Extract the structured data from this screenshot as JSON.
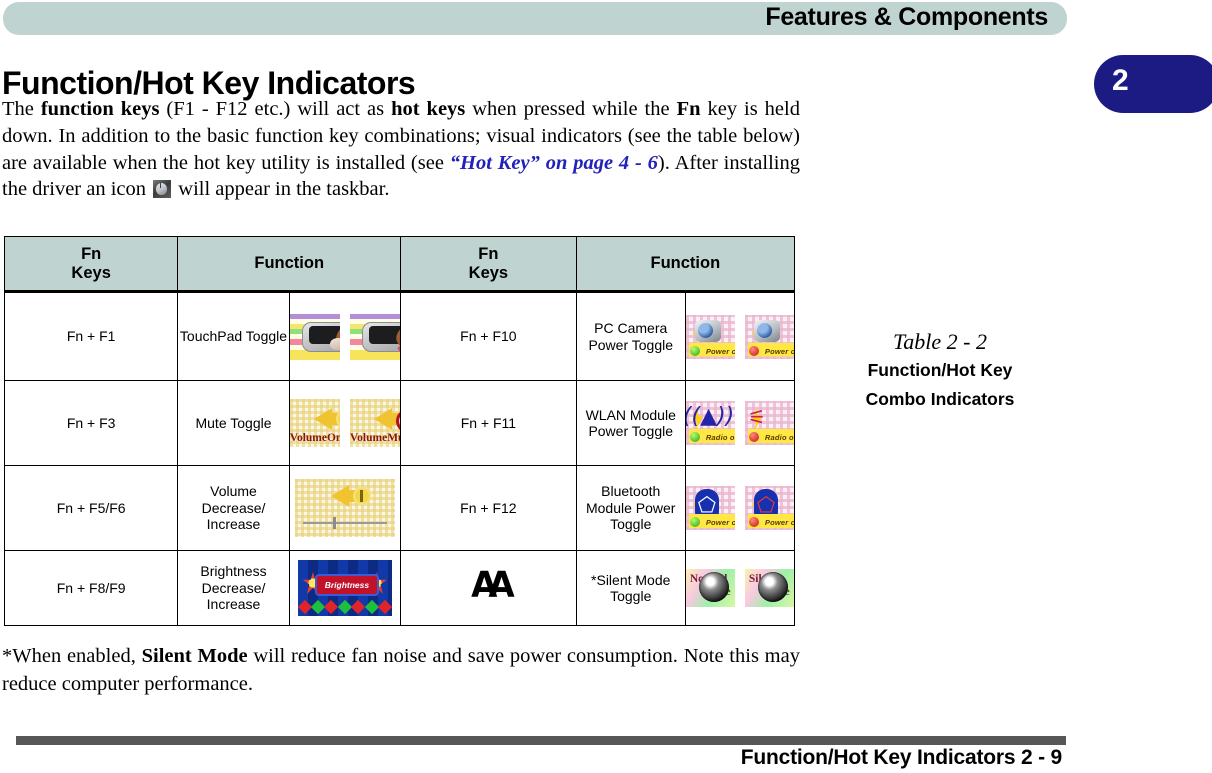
{
  "header": {
    "banner_title": "Features & Components",
    "chapter_number": "2"
  },
  "page_title": "Function/Hot Key Indicators",
  "intro": {
    "p1": "The ",
    "b1": "function keys",
    "p2": " (F1 - F12 etc.) will act as ",
    "b2": "hot keys",
    "p3": " when pressed while the ",
    "b3": "Fn",
    "p4": " key is held down. In addition to the basic function key combinations; visual indicators (see the table below) are available when the hot key utility is installed (see ",
    "xref": "“Hot Key” on page 4 - 6",
    "p5": "). After installing the driver an icon ",
    "p6": " will appear in the taskbar.",
    "taskbar_icon_name": "hotkey-taskbar-icon"
  },
  "table": {
    "headers": [
      "Fn\nKeys",
      "Function",
      "Fn\nKeys",
      "Function"
    ],
    "headers_flat": {
      "fn_keys_1": "Fn Keys",
      "function_1": "Function",
      "fn_keys_2": "Fn Keys",
      "function_2": "Function"
    },
    "rows": [
      {
        "left_key": "Fn + F1",
        "left_function": "TouchPad Toggle",
        "left_images": [
          "touchpad-enabled-image",
          "touchpad-disabled-image"
        ],
        "right_key": "Fn + F10",
        "right_function": "PC Camera Power Toggle",
        "right_images": [
          "camera-power-on-image",
          "camera-power-off-image"
        ],
        "right_image_labels": [
          "Power on",
          "Power off"
        ]
      },
      {
        "left_key": "Fn + F3",
        "left_function": "Mute Toggle",
        "left_images": [
          "volume-on-image",
          "volume-mute-image"
        ],
        "left_image_labels": [
          [
            "Volume",
            "On"
          ],
          [
            "Volume",
            "Mute"
          ]
        ],
        "right_key": "Fn + F11",
        "right_function": "WLAN Module Power Toggle",
        "right_images": [
          "radio-on-image",
          "radio-off-image"
        ],
        "right_image_labels": [
          "Radio on",
          "Radio off"
        ]
      },
      {
        "left_key": "Fn + F5/F6",
        "left_function": "Volume Decrease/ Increase",
        "left_images": [
          "volume-slider-image"
        ],
        "right_key": "Fn + F12",
        "right_function": "Bluetooth Module Power Toggle",
        "right_images": [
          "bluetooth-power-on-image",
          "bluetooth-power-off-image"
        ],
        "right_image_labels": [
          "Power on",
          "Power off"
        ]
      },
      {
        "left_key": "Fn + F8/F9",
        "left_function": "Brightness Decrease/ Increase",
        "left_images": [
          "brightness-image"
        ],
        "left_image_labels": [
          "Brightness"
        ],
        "right_key": "silent-mode-glyph",
        "right_key_glyph": "AA",
        "right_function": "*Silent Mode Toggle",
        "right_images": [
          "normal-mode-image",
          "silent-mode-image"
        ],
        "right_image_labels": [
          [
            "Normal",
            "mode"
          ],
          [
            "Silent",
            "mode"
          ]
        ]
      }
    ]
  },
  "caption": {
    "number": "Table 2 - 2",
    "line1": "Function/Hot Key",
    "line2": "Combo Indicators"
  },
  "footnote": {
    "p1": "*When enabled, ",
    "b1": "Silent Mode",
    "p2": " will reduce fan noise and save power consumption. Note this may reduce computer performance."
  },
  "footer": {
    "text": "Function/Hot Key Indicators  2  -  9"
  },
  "colors": {
    "banner": "#bfd3d0",
    "chapter_tab": "#1c1b83",
    "xref_link": "#2222bb",
    "footer_rule": "#575757"
  }
}
